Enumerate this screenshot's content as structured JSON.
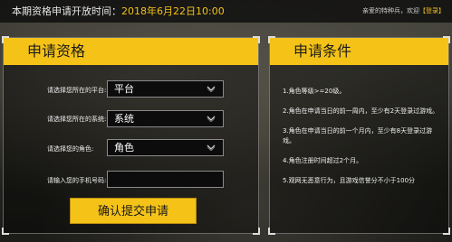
{
  "topbar": {
    "notice_prefix": "本期资格申请开放时间：",
    "notice_date": "2018年6月22日10:00",
    "welcome_text": "亲爱的特种兵，欢迎",
    "login_label": "【登录】"
  },
  "apply_panel": {
    "title": "申请资格",
    "fields": [
      {
        "label": "请选择您所在的平台:",
        "value": "平台"
      },
      {
        "label": "请选择您所在的系统:",
        "value": "系统"
      },
      {
        "label": "请选择您的角色:",
        "value": "角色"
      },
      {
        "label": "请输入您的手机号码:",
        "value": ""
      }
    ],
    "submit_label": "确认提交申请"
  },
  "conditions_panel": {
    "title": "申请条件",
    "items": [
      "1.角色等级>=20级。",
      "2.角色在申请当日的前一周内，至少有2天登录过游戏。",
      "3.角色在申请当日的前一个月内，至少有8天登录过游戏。",
      "4.角色注册时间超过2个月。",
      "5.观网无恶意行为，且游戏信誉分不小于100分"
    ]
  },
  "colors": {
    "accent": "#f5c318",
    "topbar_bg": "#0a0a0a",
    "field_bg": "#0c0c0c"
  },
  "icons": {
    "dropdown": "chevron-down-icon"
  }
}
